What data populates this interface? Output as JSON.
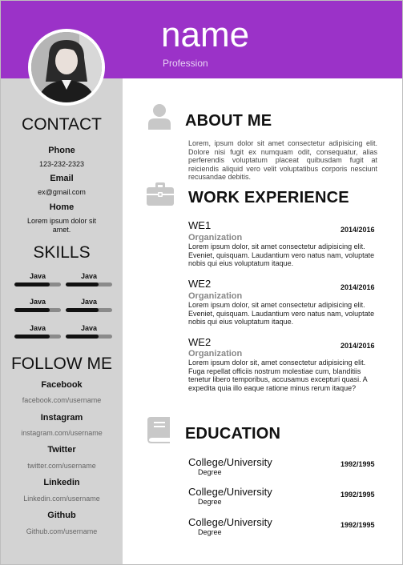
{
  "header": {
    "name": "name",
    "profession": "Profession"
  },
  "contact": {
    "title": "CONTACT",
    "phone_label": "Phone",
    "phone": "123-232-2323",
    "email_label": "Email",
    "email": "ex@gmail.com",
    "home_label": "Home",
    "home": "Lorem ipsum dolor sit amet."
  },
  "skills": {
    "title": "SKILLS",
    "items": [
      {
        "name": "Java",
        "level": 0.75
      },
      {
        "name": "Java",
        "level": 0.7
      },
      {
        "name": "Java",
        "level": 0.75
      },
      {
        "name": "Java",
        "level": 0.7
      },
      {
        "name": "Java",
        "level": 0.75
      },
      {
        "name": "Java",
        "level": 0.7
      }
    ]
  },
  "follow": {
    "title": "FOLLOW ME",
    "items": [
      {
        "label": "Facebook",
        "link": "facebook.com/username"
      },
      {
        "label": "Instagram",
        "link": "instagram.com/username"
      },
      {
        "label": "Twitter",
        "link": "twitter.com/username"
      },
      {
        "label": "Linkedin",
        "link": "Linkedin.com/username"
      },
      {
        "label": "Github",
        "link": "Github.com/username"
      }
    ]
  },
  "about": {
    "title": "ABOUT ME",
    "text": "Lorem, ipsum dolor sit amet consectetur adipisicing elit. Dolore nisi fugit ex numquam odit, consequatur, alias perferendis voluptatum placeat quibusdam fugit at reiciendis aliquid vero velit voluptatibus corporis nesciunt recusandae debitis."
  },
  "work": {
    "title": "WORK EXPERIENCE",
    "jobs": [
      {
        "title": "WE1",
        "date": "2014/2016",
        "org": "Organization",
        "desc": "Lorem ipsum dolor, sit amet consectetur adipisicing elit. Eveniet, quisquam. Laudantium vero natus nam, voluptate nobis qui eius voluptatum itaque."
      },
      {
        "title": "WE2",
        "date": "2014/2016",
        "org": "Organization",
        "desc": "Lorem ipsum dolor, sit amet consectetur adipisicing elit. Eveniet, quisquam. Laudantium vero natus nam, voluptate nobis qui eius voluptatum itaque."
      },
      {
        "title": "WE2",
        "date": "2014/2016",
        "org": "Organization",
        "desc": "Lorem ipsum dolor sit, amet consectetur adipisicing elit. Fuga repellat officiis nostrum molestiae cum, blanditiis tenetur libero temporibus, accusamus excepturi quasi. A expedita quia illo eaque ratione minus rerum itaque?"
      }
    ]
  },
  "education": {
    "title": "EDUCATION",
    "items": [
      {
        "title": "College/University",
        "degree": "Degree",
        "date": "1992/1995"
      },
      {
        "title": "College/University",
        "degree": "Degree",
        "date": "1992/1995"
      },
      {
        "title": "College/University",
        "degree": "Degree",
        "date": "1992/1995"
      }
    ]
  },
  "colors": {
    "header": "#9b32c8",
    "sidebar": "#d3d3d3",
    "icon": "#c8c8c8"
  }
}
